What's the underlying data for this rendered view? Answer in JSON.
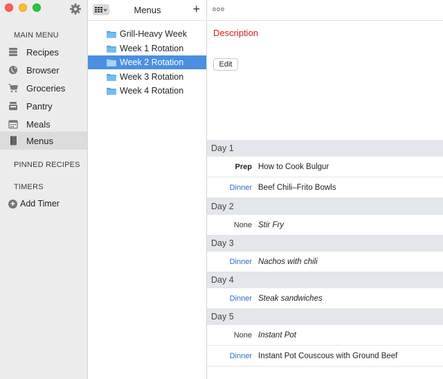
{
  "sidebar": {
    "main_menu_title": "MAIN MENU",
    "items": [
      {
        "label": "Recipes",
        "icon": "recipes-icon"
      },
      {
        "label": "Browser",
        "icon": "globe-icon"
      },
      {
        "label": "Groceries",
        "icon": "cart-icon"
      },
      {
        "label": "Pantry",
        "icon": "pantry-icon"
      },
      {
        "label": "Meals",
        "icon": "calendar-icon"
      },
      {
        "label": "Menus",
        "icon": "menus-icon"
      }
    ],
    "pinned_title": "PINNED RECIPES",
    "timers_title": "TIMERS",
    "add_timer": "Add Timer"
  },
  "middle": {
    "title": "Menus",
    "add_symbol": "+",
    "folders": [
      {
        "label": "Grill-Heavy Week"
      },
      {
        "label": "Week 1 Rotation"
      },
      {
        "label": "Week 2 Rotation"
      },
      {
        "label": "Week 3 Rotation"
      },
      {
        "label": "Week 4 Rotation"
      }
    ]
  },
  "detail": {
    "more_symbol": "ooo",
    "description_label": "Description",
    "edit_label": "Edit",
    "days": [
      {
        "label": "Day 1"
      },
      {
        "label": "Day 2"
      },
      {
        "label": "Day 3"
      },
      {
        "label": "Day 4"
      },
      {
        "label": "Day 5"
      }
    ],
    "meals": [
      {
        "type": "Prep",
        "name": "How to Cook Bulgur"
      },
      {
        "type": "Dinner",
        "name": "Beef Chili–Frito Bowls"
      },
      {
        "type": "None",
        "name": "Stir Fry"
      },
      {
        "type": "Dinner",
        "name": "Nachos with chili"
      },
      {
        "type": "Dinner",
        "name": "Steak sandwiches"
      },
      {
        "type": "None",
        "name": "Instant Pot"
      },
      {
        "type": "Dinner",
        "name": "Instant Pot Couscous with Ground Beef"
      }
    ]
  },
  "colors": {
    "accent_selected": "#4a8fe0",
    "description_red": "#d2201b",
    "dinner_blue": "#2e67c4",
    "day_header_bg": "#e3e6ea"
  }
}
